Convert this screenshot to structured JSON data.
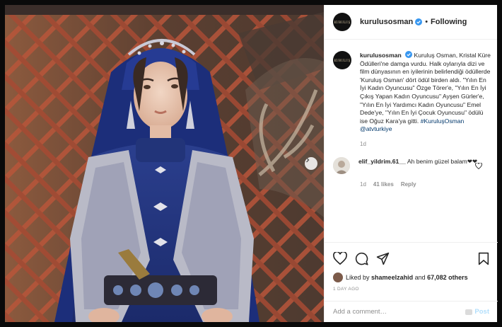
{
  "header": {
    "avatar_text": "KURULUŞ",
    "username": "kurulusosman",
    "separator": "•",
    "follow_label": "Following"
  },
  "caption": {
    "username": "kurulusosman",
    "text": "Kuruluş Osman, Kristal Küre Ödülleri'ne damga vurdu. Halk oylarıyla dizi ve film dünyasının en iyilerinin belirlendiği ödüllerde 'Kuruluş Osman' dört ödül birden aldı. \"Yılın En İyi Kadın Oyuncusu\" Özge Törer'e, \"Yılın En İyi Çıkış Yapan Kadın Oyuncusu\" Ayşen Gürler'e, \"Yılın En İyi Yardımcı Kadın Oyuncusu\" Emel Dede'ye, \"Yılın En İyi Çocuk Oyuncusu\" ödülü ise Oğuz Kara'ya gitti.",
    "hashtag": "#KuruluşOsman",
    "mention": "@atvturkiye",
    "time": "1d"
  },
  "comment": {
    "username": "elif_yildrim.61__",
    "text": "Ah benim güzel balam❤❤",
    "time": "1d",
    "likes": "41 likes",
    "reply": "Reply"
  },
  "likes": {
    "prefix": "Liked by",
    "user": "shameelzahid",
    "middle": "and",
    "count": "67,082 others"
  },
  "post_time": "1 DAY AGO",
  "add_comment": {
    "placeholder": "Add a comment…",
    "post_label": "Post"
  },
  "colors": {
    "link": "#00376b",
    "verified": "#3897f0",
    "muted": "#8e8e8e",
    "post_button": "#b2dffc"
  },
  "icons": [
    "next-arrow-icon",
    "verified-badge-icon",
    "heart-icon",
    "comment-icon",
    "share-icon",
    "bookmark-icon"
  ]
}
